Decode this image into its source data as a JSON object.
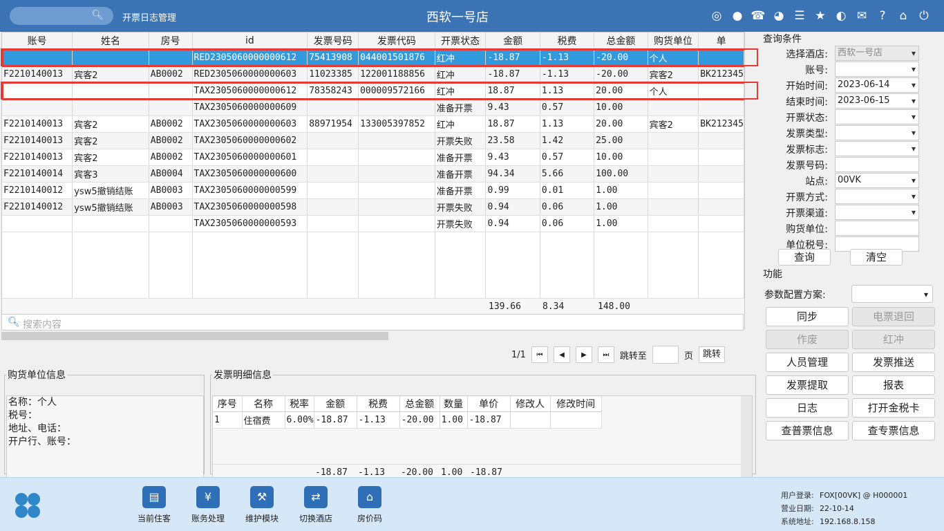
{
  "header": {
    "module_title": "开票日志管理",
    "store_name": "西软一号店",
    "icons": [
      "wifi-icon",
      "chat-icon",
      "phone-icon",
      "palette-icon",
      "menu-icon",
      "star-icon",
      "contrast-icon",
      "mail-icon",
      "help-icon",
      "home-icon",
      "power-icon"
    ]
  },
  "grid": {
    "columns": [
      "账号",
      "姓名",
      "房号",
      "id",
      "发票号码",
      "发票代码",
      "开票状态",
      "金额",
      "税费",
      "总金额",
      "购货单位",
      "单"
    ],
    "rows": [
      [
        "",
        "",
        "",
        "RED2305060000000612",
        "75413908",
        "044001501876",
        "红冲",
        "-18.87",
        "-1.13",
        "-20.00",
        "个人",
        ""
      ],
      [
        "F2210140013",
        "宾客2",
        "AB0002",
        "RED2305060000000603",
        "11023385",
        "122001188856",
        "红冲",
        "-18.87",
        "-1.13",
        "-20.00",
        "宾客2",
        "BK212345"
      ],
      [
        "",
        "",
        "",
        "TAX2305060000000612",
        "78358243",
        "000009572166",
        "红冲",
        "18.87",
        "1.13",
        "20.00",
        "个人",
        ""
      ],
      [
        "",
        "",
        "",
        "TAX2305060000000609",
        "",
        "",
        "准备开票",
        "9.43",
        "0.57",
        "10.00",
        "",
        ""
      ],
      [
        "F2210140013",
        "宾客2",
        "AB0002",
        "TAX2305060000000603",
        "88971954",
        "133005397852",
        "红冲",
        "18.87",
        "1.13",
        "20.00",
        "宾客2",
        "BK212345"
      ],
      [
        "F2210140013",
        "宾客2",
        "AB0002",
        "TAX2305060000000602",
        "",
        "",
        "开票失败",
        "23.58",
        "1.42",
        "25.00",
        "",
        ""
      ],
      [
        "F2210140013",
        "宾客2",
        "AB0002",
        "TAX2305060000000601",
        "",
        "",
        "准备开票",
        "9.43",
        "0.57",
        "10.00",
        "",
        ""
      ],
      [
        "F2210140014",
        "宾客3",
        "AB0004",
        "TAX2305060000000600",
        "",
        "",
        "准备开票",
        "94.34",
        "5.66",
        "100.00",
        "",
        ""
      ],
      [
        "F2210140012",
        "ysw5撤销结账",
        "AB0003",
        "TAX2305060000000599",
        "",
        "",
        "准备开票",
        "0.99",
        "0.01",
        "1.00",
        "",
        ""
      ],
      [
        "F2210140012",
        "ysw5撤销结账",
        "AB0003",
        "TAX2305060000000598",
        "",
        "",
        "开票失败",
        "0.94",
        "0.06",
        "1.00",
        "",
        ""
      ],
      [
        "",
        "",
        "",
        "TAX2305060000000593",
        "",
        "",
        "开票失败",
        "0.94",
        "0.06",
        "1.00",
        "",
        ""
      ]
    ],
    "totals": {
      "amount": "139.66",
      "tax": "8.34",
      "total": "148.00"
    },
    "search_placeholder": "搜索内容"
  },
  "pager": {
    "page": "1/1",
    "jump_to": "跳转至",
    "page_unit": "页",
    "jump_button": "跳转"
  },
  "buyer": {
    "title": "购货单位信息",
    "lines": [
      "名称：个人",
      "税号：",
      "地址、电话：",
      "开户行、账号："
    ]
  },
  "detail": {
    "title": "发票明细信息",
    "columns": [
      "序号",
      "名称",
      "税率",
      "金额",
      "税费",
      "总金额",
      "数量",
      "单价",
      "修改人",
      "修改时间"
    ],
    "rows": [
      [
        "1",
        "住宿费",
        "6.00%",
        "-18.87",
        "-1.13",
        "-20.00",
        "1.00",
        "-18.87",
        "",
        ""
      ]
    ],
    "totals": {
      "amount": "-18.87",
      "tax": "-1.13",
      "total": "-20.00",
      "qty": "1.00",
      "price": "-18.87"
    }
  },
  "query": {
    "title": "查询条件",
    "fields": [
      {
        "label": "选择酒店:",
        "value": "西软一号店",
        "dropdown": true,
        "disabled": true
      },
      {
        "label": "账号:",
        "value": "",
        "dropdown": true
      },
      {
        "label": "开始时间:",
        "value": "2023-06-14",
        "dropdown": true
      },
      {
        "label": "结束时间:",
        "value": "2023-06-15",
        "dropdown": true
      },
      {
        "label": "开票状态:",
        "value": "",
        "dropdown": true
      },
      {
        "label": "发票类型:",
        "value": "",
        "dropdown": true
      },
      {
        "label": "发票标志:",
        "value": "",
        "dropdown": true
      },
      {
        "label": "发票号码:",
        "value": "",
        "dropdown": false
      },
      {
        "label": "站点:",
        "value": "00VK",
        "dropdown": true
      },
      {
        "label": "开票方式:",
        "value": "",
        "dropdown": true
      },
      {
        "label": "开票渠道:",
        "value": "",
        "dropdown": true
      },
      {
        "label": "购货单位:",
        "value": "",
        "dropdown": false
      },
      {
        "label": "单位税号:",
        "value": "",
        "dropdown": false
      }
    ],
    "query_button": "查询",
    "clear_button": "清空"
  },
  "functions": {
    "title": "功能",
    "config_label": "参数配置方案:",
    "config_value": "",
    "buttons": [
      {
        "label": "同步",
        "disabled": false
      },
      {
        "label": "电票退回",
        "disabled": true
      },
      {
        "label": "作废",
        "disabled": true
      },
      {
        "label": "红冲",
        "disabled": true
      },
      {
        "label": "人员管理",
        "disabled": false
      },
      {
        "label": "发票推送",
        "disabled": false
      },
      {
        "label": "发票提取",
        "disabled": false
      },
      {
        "label": "报表",
        "disabled": false
      },
      {
        "label": "日志",
        "disabled": false
      },
      {
        "label": "打开金税卡",
        "disabled": false
      },
      {
        "label": "查普票信息",
        "disabled": false
      },
      {
        "label": "查专票信息",
        "disabled": false
      }
    ]
  },
  "footer": {
    "nav": [
      {
        "label": "当前住客",
        "icon": "id-card-icon"
      },
      {
        "label": "账务处理",
        "icon": "money-icon"
      },
      {
        "label": "维护模块",
        "icon": "wrench-icon"
      },
      {
        "label": "切换酒店",
        "icon": "switch-icon"
      },
      {
        "label": "房价码",
        "icon": "house-icon"
      }
    ],
    "user_label": "用户登录:",
    "user_value": "FOX[00VK] @ H000001",
    "date_label": "营业日期:",
    "date_value": "22-10-14",
    "addr_label": "系统地址:",
    "addr_value": "192.168.8.158"
  },
  "colors": {
    "header": "#3b73b5",
    "selection": "#3399dd",
    "highlight": "#e53935",
    "footer": "#d6e7f7"
  }
}
